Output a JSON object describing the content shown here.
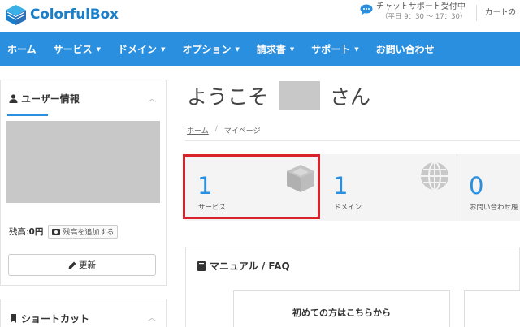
{
  "header": {
    "logo_text": "ColorfulBox",
    "chat_title": "チャットサポート受付中",
    "chat_hours": "（平日 9：30 ～ 17：30）",
    "cart": "カートの"
  },
  "nav": {
    "items": [
      {
        "label": "ホーム",
        "caret": ""
      },
      {
        "label": "サービス",
        "caret": "▼"
      },
      {
        "label": "ドメイン",
        "caret": "▼"
      },
      {
        "label": "オプション",
        "caret": "▼"
      },
      {
        "label": "請求書",
        "caret": "▼"
      },
      {
        "label": "サポート",
        "caret": "▼"
      },
      {
        "label": "お問い合わせ",
        "caret": ""
      }
    ]
  },
  "sidebar": {
    "user_title": "ユーザー情報",
    "balance_label": "残高:",
    "balance_value": "0円",
    "add_balance": "残高を追加する",
    "update": "更新",
    "shortcut_title": "ショートカット"
  },
  "main": {
    "welcome_prefix": "ようこそ",
    "welcome_suffix": "さん",
    "breadcrumb": {
      "home": "ホーム",
      "sep": "/",
      "current": "マイページ"
    },
    "stats": [
      {
        "value": "1",
        "label": "サービス",
        "icon": "cube-icon"
      },
      {
        "value": "1",
        "label": "ドメイン",
        "icon": "globe-icon"
      },
      {
        "value": "0",
        "label": "お問い合わせ履",
        "icon": ""
      }
    ],
    "faq_title": "マニュアル / FAQ",
    "faq_card": "初めての方はこちらから"
  },
  "colors": {
    "brand": "#1a7fc8",
    "nav": "#2a8fdf",
    "highlight": "#d8232a"
  }
}
